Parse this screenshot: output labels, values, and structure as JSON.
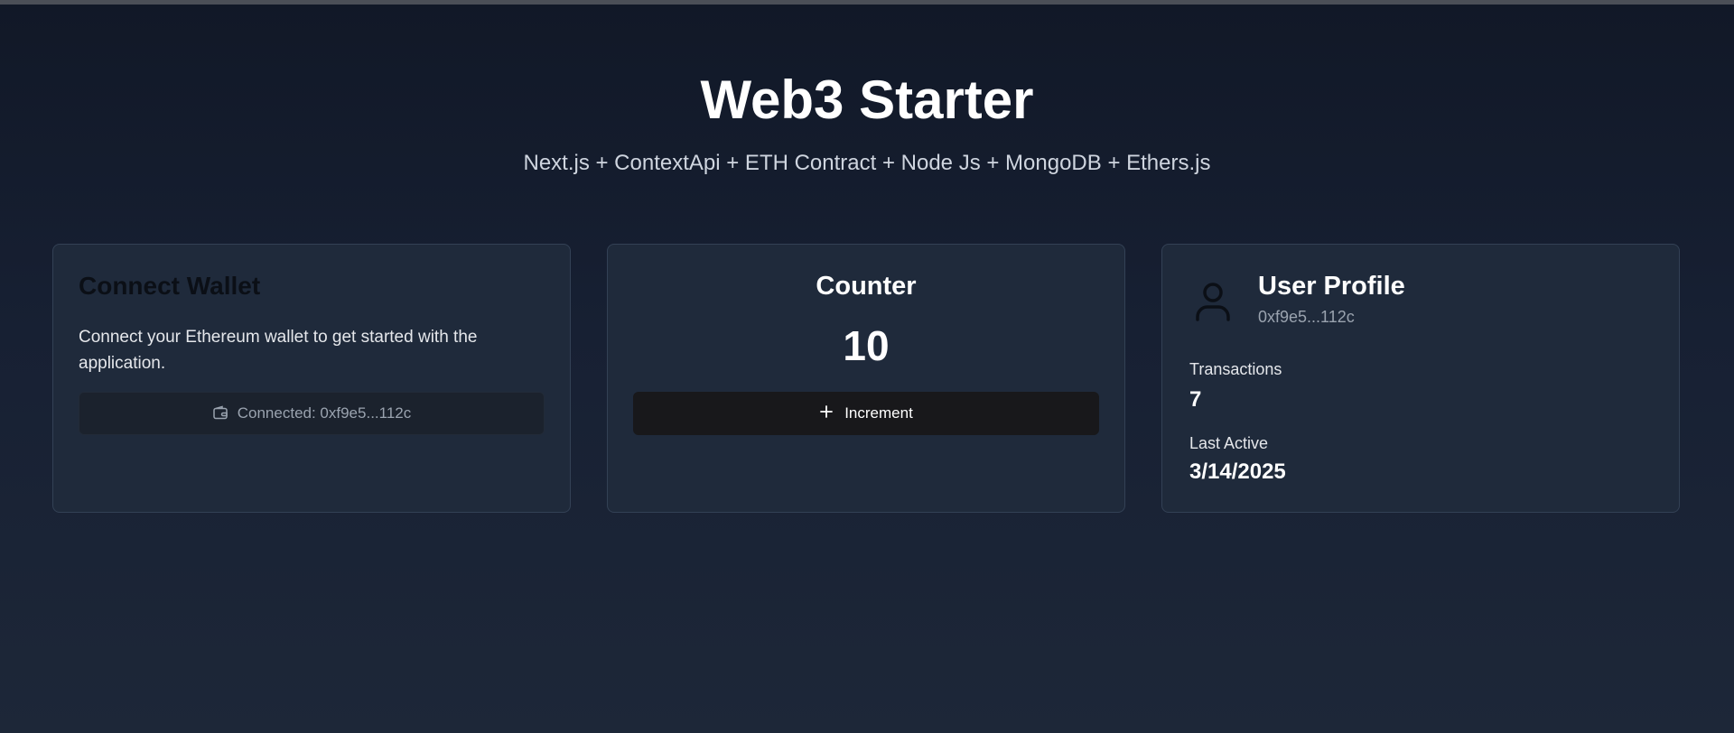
{
  "header": {
    "title": "Web3 Starter",
    "subtitle": "Next.js + ContextApi + ETH Contract + Node Js + MongoDB + Ethers.js"
  },
  "wallet_card": {
    "title": "Connect Wallet",
    "description": "Connect your Ethereum wallet to get started with the application.",
    "button_label": "Connected: 0xf9e5...112c",
    "button_icon": "wallet-icon"
  },
  "counter_card": {
    "title": "Counter",
    "value": "10",
    "button_label": "Increment",
    "button_icon": "plus-icon"
  },
  "profile_card": {
    "title": "User Profile",
    "address": "0xf9e5...112c",
    "avatar_icon": "user-icon",
    "transactions_label": "Transactions",
    "transactions_value": "7",
    "last_active_label": "Last Active",
    "last_active_value": "3/14/2025"
  },
  "colors": {
    "background_top": "#111827",
    "background_bottom": "#1d2738",
    "card_background": "#1f2a3b",
    "card_border": "#334155",
    "primary_button": "#18181b",
    "disabled_button": "#1b222d",
    "muted_text": "#9aa3af"
  }
}
